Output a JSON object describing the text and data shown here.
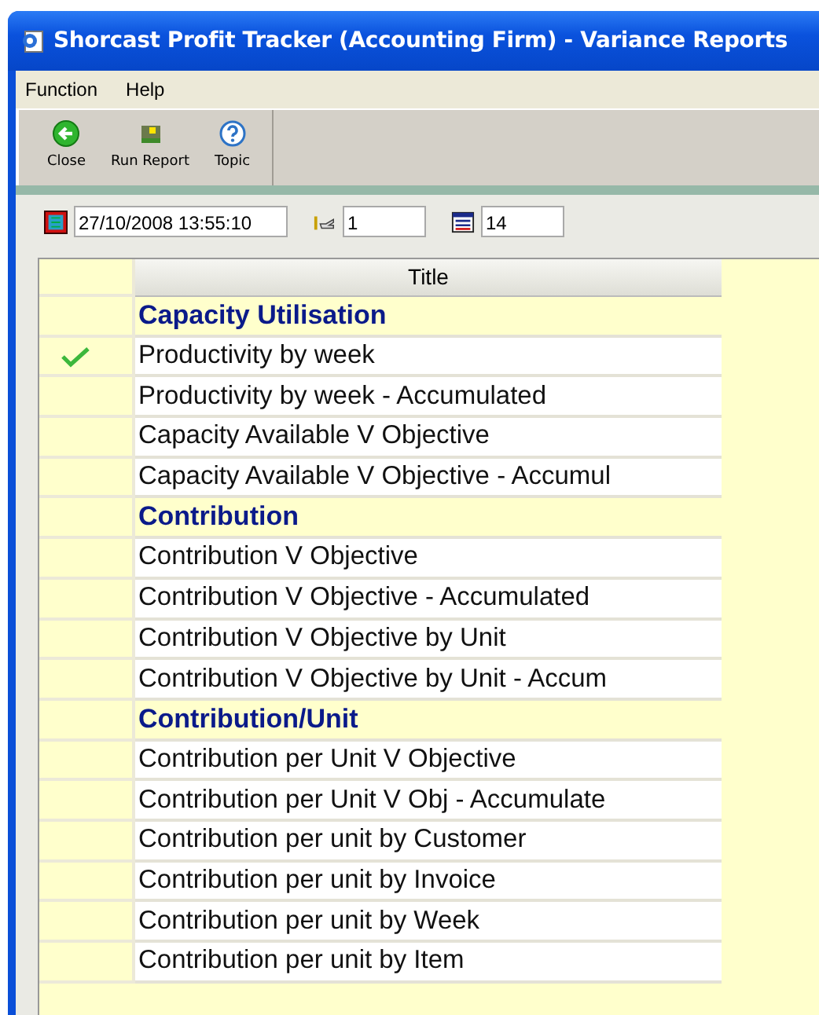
{
  "window": {
    "title": "Shorcast Profit Tracker (Accounting Firm) - Variance Reports"
  },
  "menu": [
    "Function",
    "Help"
  ],
  "toolbar": [
    {
      "label": "Close"
    },
    {
      "label": "Run Report"
    },
    {
      "label": "Topic"
    }
  ],
  "filters": [
    {
      "value": "27/10/2008 13:55:10"
    },
    {
      "value": "1"
    },
    {
      "value": "14"
    }
  ],
  "table": {
    "columns": [
      "Title"
    ],
    "rows": [
      {
        "kind": "group",
        "title": "Capacity Utilisation",
        "checked": false
      },
      {
        "kind": "item",
        "title": "Productivity by week",
        "checked": true
      },
      {
        "kind": "item",
        "title": "Productivity by week - Accumulated",
        "checked": false
      },
      {
        "kind": "item",
        "title": "Capacity Available V Objective",
        "checked": false
      },
      {
        "kind": "item",
        "title": "Capacity Available V Objective - Accumul",
        "checked": false
      },
      {
        "kind": "group",
        "title": "Contribution",
        "checked": false
      },
      {
        "kind": "item",
        "title": "Contribution V Objective",
        "checked": false
      },
      {
        "kind": "item",
        "title": "Contribution V Objective - Accumulated",
        "checked": false
      },
      {
        "kind": "item",
        "title": "Contribution V Objective by Unit",
        "checked": false
      },
      {
        "kind": "item",
        "title": "Contribution V Objective by Unit - Accum",
        "checked": false
      },
      {
        "kind": "group",
        "title": "Contribution/Unit",
        "checked": false
      },
      {
        "kind": "item",
        "title": "Contribution per Unit V Objective",
        "checked": false
      },
      {
        "kind": "item",
        "title": "Contribution per Unit V Obj - Accumulate",
        "checked": false
      },
      {
        "kind": "item",
        "title": "Contribution per unit by Customer",
        "checked": false
      },
      {
        "kind": "item",
        "title": "Contribution per unit by Invoice",
        "checked": false
      },
      {
        "kind": "item",
        "title": "Contribution per unit by Week",
        "checked": false
      },
      {
        "kind": "item",
        "title": "Contribution per unit by Item",
        "checked": false
      }
    ]
  }
}
